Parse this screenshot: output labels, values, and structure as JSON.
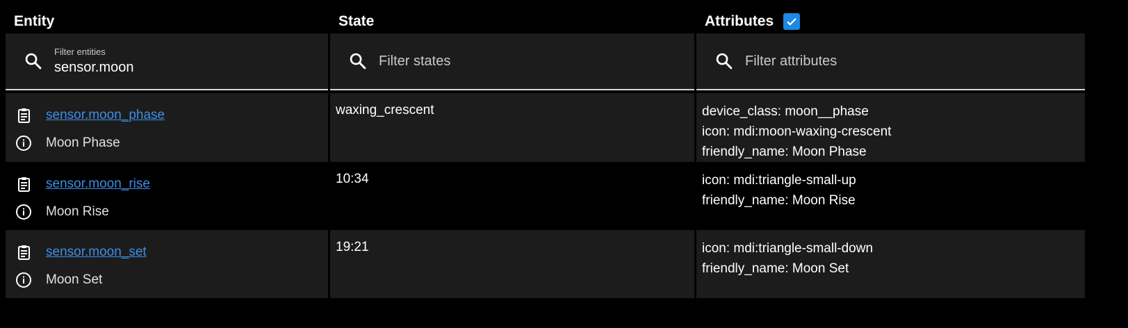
{
  "headers": {
    "entity": "Entity",
    "state": "State",
    "attributes": "Attributes",
    "attributes_checkbox_checked": true
  },
  "filters": {
    "entity": {
      "label": "Filter entities",
      "value": "sensor.moon"
    },
    "state": {
      "placeholder": "Filter states",
      "value": ""
    },
    "attributes": {
      "placeholder": "Filter attributes",
      "value": ""
    }
  },
  "rows": [
    {
      "entity_id": "sensor.moon_phase",
      "name": "Moon Phase",
      "state": "waxing_crescent",
      "attributes": [
        "device_class: moon__phase",
        "icon: mdi:moon-waxing-crescent",
        "friendly_name: Moon Phase"
      ]
    },
    {
      "entity_id": "sensor.moon_rise",
      "name": "Moon Rise",
      "state": "10:34",
      "attributes": [
        "icon: mdi:triangle-small-up",
        "friendly_name: Moon Rise"
      ]
    },
    {
      "entity_id": "sensor.moon_set",
      "name": "Moon Set",
      "state": "19:21",
      "attributes": [
        "icon: mdi:triangle-small-down",
        "friendly_name: Moon Set"
      ]
    }
  ],
  "colors": {
    "accent": "#1e88e5",
    "link": "#3c8ee8",
    "row_bg": "#1c1c1c",
    "background": "#000000"
  },
  "icons": {
    "filter": "magnify-icon",
    "copy": "clipboard-text-icon",
    "info": "information-outline-icon",
    "checkbox": "checkbox-marked-icon"
  }
}
